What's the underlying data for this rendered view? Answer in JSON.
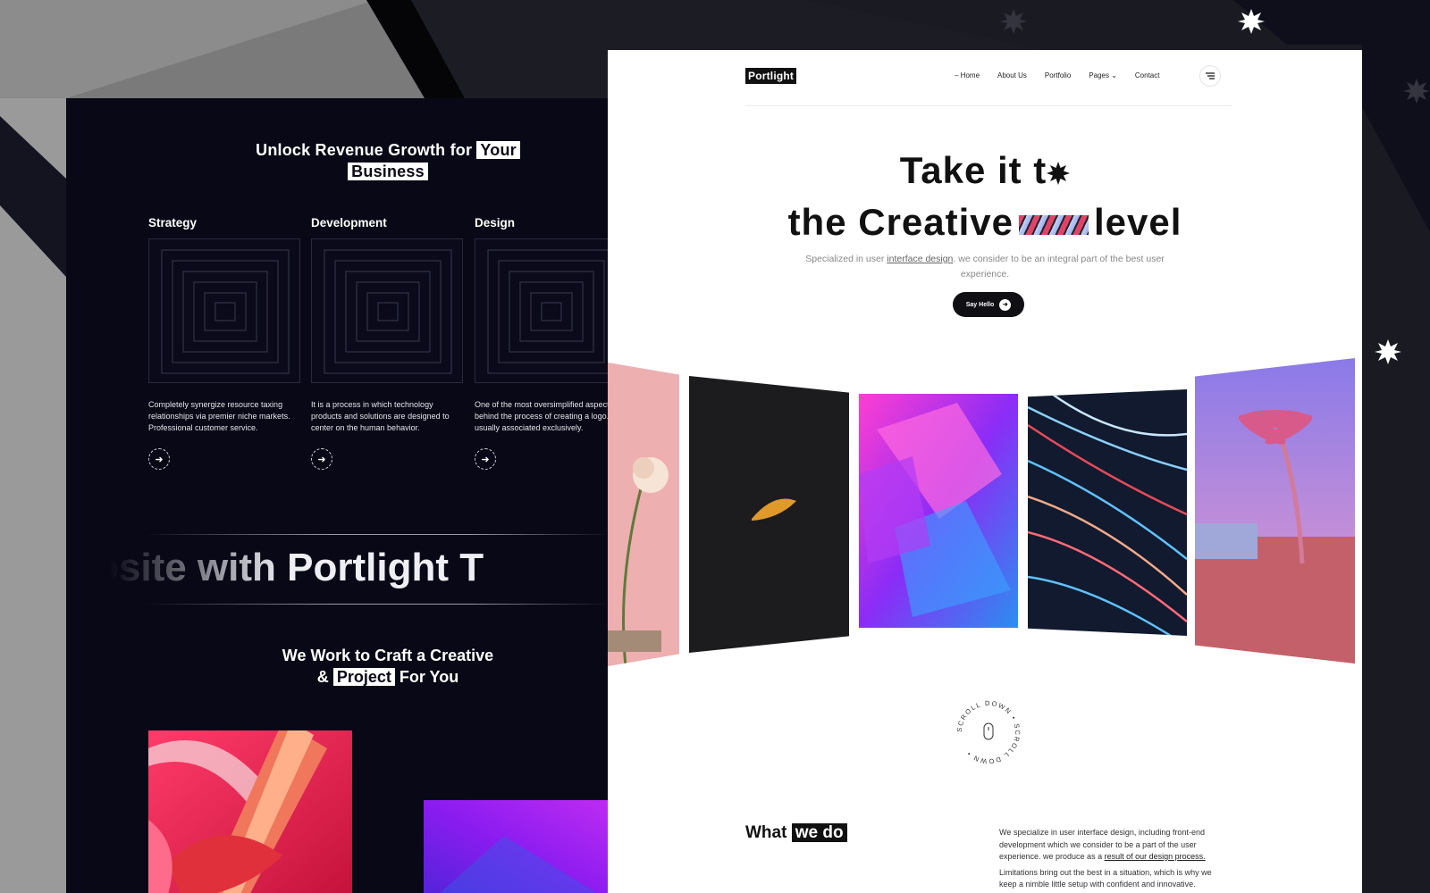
{
  "dark_page": {
    "headline_pre": "Unlock Revenue Growth for",
    "headline_hl1": "Your",
    "headline_hl2": "Business",
    "services": [
      {
        "title": "Strategy",
        "text": "Completely synergize resource taxing relationships via premier niche markets. Professional customer service."
      },
      {
        "title": "Development",
        "text": "It is a process in which technology products and solutions are designed to center on the human behavior."
      },
      {
        "title": "Design",
        "text": "One of the most oversimplified aspects behind the process of creating a logo. It’s usually associated exclusively."
      }
    ],
    "marquee": "osite with Portlight T",
    "craft_line1": "We Work to Craft a Creative",
    "craft_amp": "&",
    "craft_hl": "Project",
    "craft_end": "For You"
  },
  "light_page": {
    "logo": "Portlight",
    "nav": [
      "Home",
      "About Us",
      "Portfolio",
      "Pages",
      "Contact"
    ],
    "hero_line1": "Take it t",
    "hero_line2_a": "the Creative",
    "hero_line2_b": "level",
    "subtitle_pre": "Specialized in user ",
    "subtitle_link": "interface design",
    "subtitle_post": ". we consider to be an integral part of the best user experience.",
    "cta": "Say Hello",
    "scroll_text": "SCROLL DOWN • SCROLL DOWN • ",
    "what_pre": "What",
    "what_hl": "we do",
    "what_p1_pre": "We specialize in user interface design, including front-end development which we consider to be a part of the user experience. we produce as a ",
    "what_p1_link": "result of our design process.",
    "what_p2": "Limitations bring out the best in a situation, which is why we keep a nimble little setup with  confident and innovative."
  },
  "colors": {
    "dark_bg": "#080816",
    "accent_pink": "#e0436a",
    "white_bg": "#ffffff"
  }
}
